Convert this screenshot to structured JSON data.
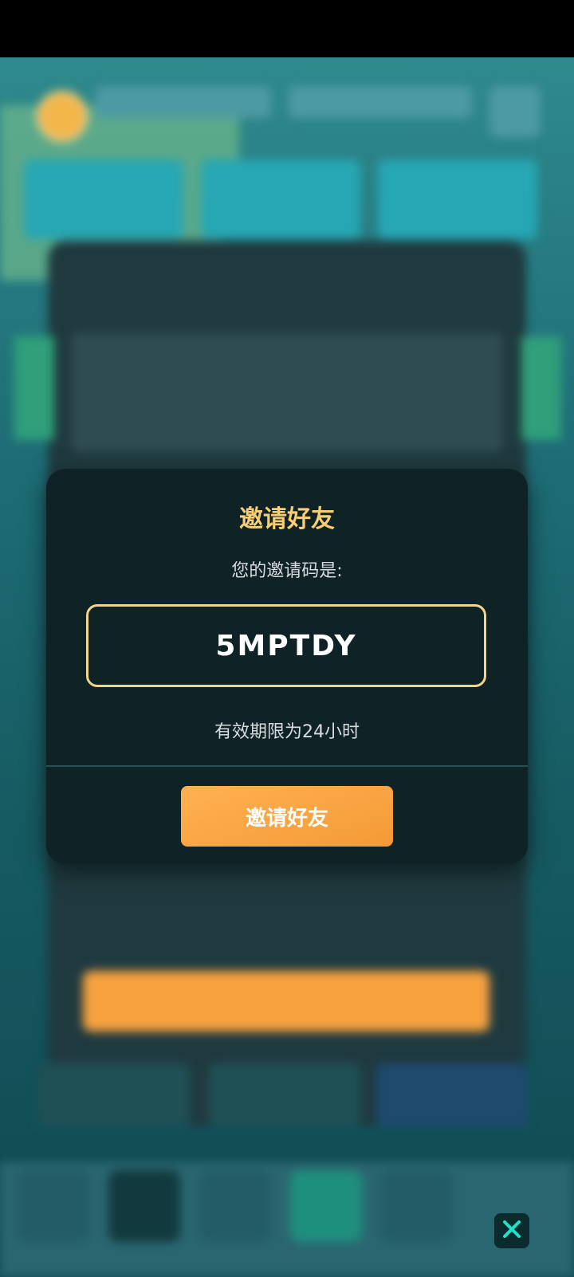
{
  "modal": {
    "title": "邀请好友",
    "subtitle": "您的邀请码是:",
    "code": "5MPTDY",
    "expiry": "有效期限为24小时",
    "invite_button": "邀请好友"
  },
  "icons": {
    "close": "close-icon"
  },
  "colors": {
    "title": "#f7cd76",
    "code_border": "#f2d48b",
    "button": "#f7a13f",
    "close_icon": "#1de2c7"
  }
}
